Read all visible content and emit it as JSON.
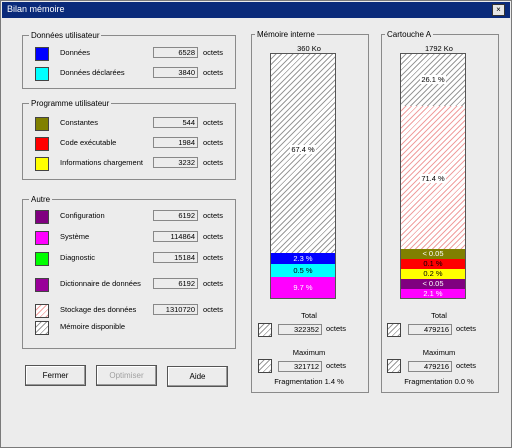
{
  "window": {
    "title": "Bilan mémoire",
    "close_glyph": "×"
  },
  "user_data": {
    "title": "Données utilisateur",
    "rows": [
      {
        "label": "Données",
        "value": "6528",
        "unit": "octets",
        "color": "#0000ff"
      },
      {
        "label": "Données déclarées",
        "value": "3840",
        "unit": "octets",
        "color": "#00ffff"
      }
    ]
  },
  "user_program": {
    "title": "Programme utilisateur",
    "rows": [
      {
        "label": "Constantes",
        "value": "544",
        "unit": "octets",
        "color": "#808000"
      },
      {
        "label": "Code exécutable",
        "value": "1984",
        "unit": "octets",
        "color": "#ff0000"
      },
      {
        "label": "Informations chargement",
        "value": "3232",
        "unit": "octets",
        "color": "#ffff00"
      }
    ]
  },
  "other": {
    "title": "Autre",
    "rows": [
      {
        "label": "Configuration",
        "value": "6192",
        "unit": "octets",
        "color": "#800080"
      },
      {
        "label": "Système",
        "value": "114864",
        "unit": "octets",
        "color": "#ff00ff"
      },
      {
        "label": "Diagnostic",
        "value": "15184",
        "unit": "octets",
        "color": "#00ff00"
      },
      {
        "label": "Dictionnaire de données",
        "value": "6192",
        "unit": "octets",
        "color": "#990099"
      },
      {
        "label": "Stockage des données",
        "value": "1310720",
        "unit": "octets",
        "color": "pattern-red"
      },
      {
        "label": "Mémoire disponible",
        "color": "pattern-gray"
      }
    ]
  },
  "buttons": {
    "close": "Fermer",
    "optimize": "Optimiser",
    "help": "Aide"
  },
  "internal": {
    "title": "Mémoire interne",
    "capacity": "360 Ko",
    "segments": [
      {
        "label": "67.4 %",
        "color": "pattern-gray"
      },
      {
        "label": "2.3 %",
        "color": "#0000ff"
      },
      {
        "label": "0.5 %",
        "color": "#00ffff"
      },
      {
        "label": "9.7 %",
        "color": "#ff00ff"
      }
    ],
    "total_label": "Total",
    "total_value": "322352",
    "total_unit": "octets",
    "max_label": "Maximum",
    "max_value": "321712",
    "max_unit": "octets",
    "fragmentation": "Fragmentation 1.4 %"
  },
  "cartridge": {
    "title": "Cartouche A",
    "capacity": "1792 Ko",
    "segments": [
      {
        "label": "26.1 %",
        "color": "pattern-gray"
      },
      {
        "label": "71.4 %",
        "color": "pattern-red"
      },
      {
        "label": "< 0.05",
        "color": "#808000"
      },
      {
        "label": "0.1 %",
        "color": "#ff0000"
      },
      {
        "label": "0.2 %",
        "color": "#ffff00"
      },
      {
        "label": "< 0.05",
        "color": "#800080"
      },
      {
        "label": "2.1 %",
        "color": "#ff00ff"
      }
    ],
    "total_label": "Total",
    "total_value": "479216",
    "total_unit": "octets",
    "max_label": "Maximum",
    "max_value": "479216",
    "max_unit": "octets",
    "fragmentation": "Fragmentation 0.0 %"
  }
}
